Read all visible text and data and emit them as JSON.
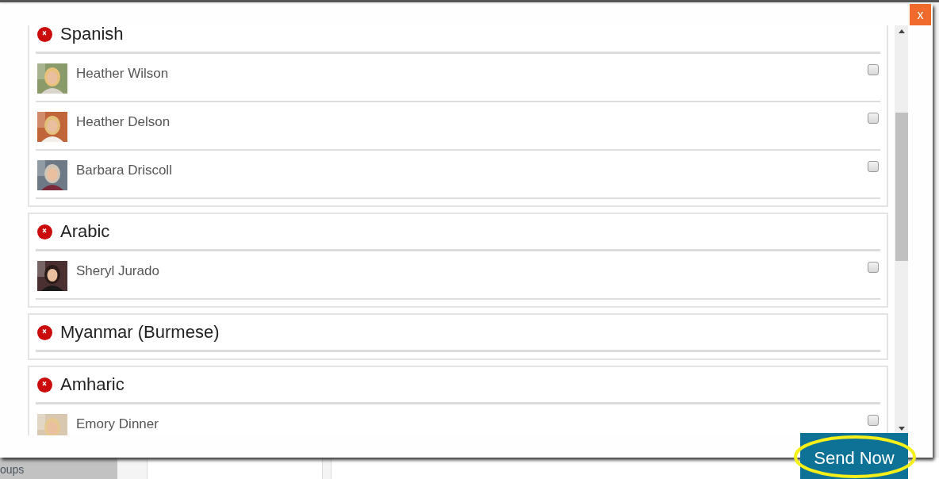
{
  "close_button": {
    "label": "x"
  },
  "groups": [
    {
      "name": "Spanish",
      "members": [
        {
          "name": "Heather Wilson",
          "checked": false
        },
        {
          "name": "Heather Delson",
          "checked": false
        },
        {
          "name": "Barbara Driscoll",
          "checked": false
        }
      ]
    },
    {
      "name": "Arabic",
      "members": [
        {
          "name": "Sheryl Jurado",
          "checked": false
        }
      ]
    },
    {
      "name": "Myanmar (Burmese)"
    },
    {
      "name": "Amharic",
      "members": [
        {
          "name": "Emory Dinner",
          "checked": false
        }
      ]
    }
  ],
  "send_button": {
    "label": "Send Now"
  },
  "sidebar": {
    "items": [
      "oups"
    ]
  }
}
